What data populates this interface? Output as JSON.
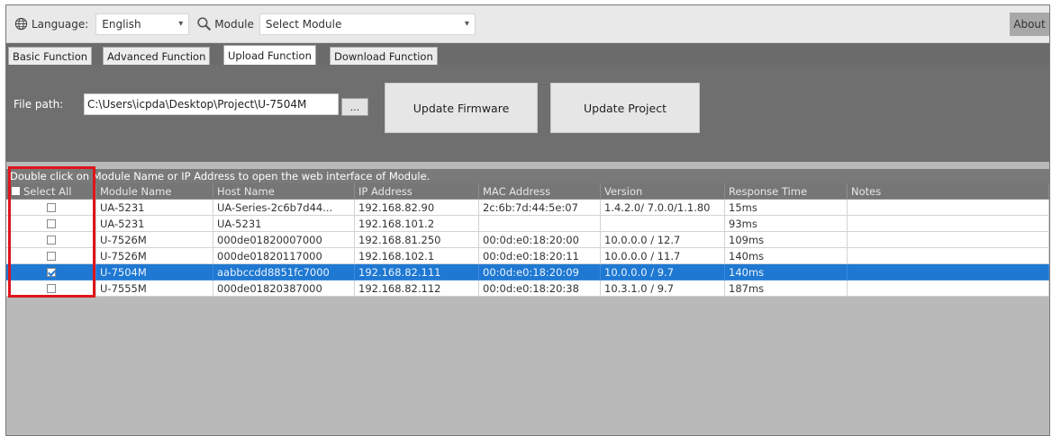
{
  "toolbar": {
    "language_label": "Language:",
    "language_value": "English",
    "module_label": "Module",
    "module_value": "Select Module",
    "about_label": "About"
  },
  "tabs": [
    {
      "label": "Basic Function"
    },
    {
      "label": "Advanced Function"
    },
    {
      "label": "Upload Function"
    },
    {
      "label": "Download Function"
    }
  ],
  "active_tab": "Upload Function",
  "upload": {
    "file_path_label": "File path:",
    "file_path_value": "C:\\Users\\icpda\\Desktop\\Project\\U-7504M",
    "browse_label": "...",
    "update_firmware_label": "Update Firmware",
    "update_project_label": "Update Project"
  },
  "hint": "Double click on Module Name or IP Address to open the web interface of Module.",
  "table": {
    "columns": [
      "Select All",
      "Module Name",
      "Host Name",
      "IP Address",
      "MAC Address",
      "Version",
      "Response Time",
      "Notes"
    ],
    "rows": [
      {
        "checked": false,
        "module": "UA-5231",
        "host": "UA-Series-2c6b7d44...",
        "ip": "192.168.82.90",
        "mac": "2c:6b:7d:44:5e:07",
        "version": "1.4.2.0/ 7.0.0/1.1.80",
        "response": "15ms",
        "notes": ""
      },
      {
        "checked": false,
        "module": "UA-5231",
        "host": "UA-5231",
        "ip": "192.168.101.2",
        "mac": "",
        "version": "",
        "response": "93ms",
        "notes": ""
      },
      {
        "checked": false,
        "module": "U-7526M",
        "host": "000de01820007000",
        "ip": "192.168.81.250",
        "mac": "00:0d:e0:18:20:00",
        "version": "10.0.0.0 / 12.7",
        "response": "109ms",
        "notes": ""
      },
      {
        "checked": false,
        "module": "U-7526M",
        "host": "000de01820117000",
        "ip": "192.168.102.1",
        "mac": "00:0d:e0:18:20:11",
        "version": "10.0.0.0 / 11.7",
        "response": "140ms",
        "notes": ""
      },
      {
        "checked": true,
        "module": "U-7504M",
        "host": "aabbccdd8851fc7000",
        "ip": "192.168.82.111",
        "mac": "00:0d:e0:18:20:09",
        "version": "10.0.0.0 / 9.7",
        "response": "140ms",
        "notes": "",
        "selected": true
      },
      {
        "checked": false,
        "module": "U-7555M",
        "host": "000de01820387000",
        "ip": "192.168.82.112",
        "mac": "00:0d:e0:18:20:38",
        "version": "10.3.1.0 / 9.7",
        "response": "187ms",
        "notes": ""
      }
    ]
  },
  "colors": {
    "selected_row": "#1f78d1",
    "highlight_box": "#e0141b",
    "panel_dark": "#6f6f6f",
    "empty_area": "#b9b9b9"
  }
}
